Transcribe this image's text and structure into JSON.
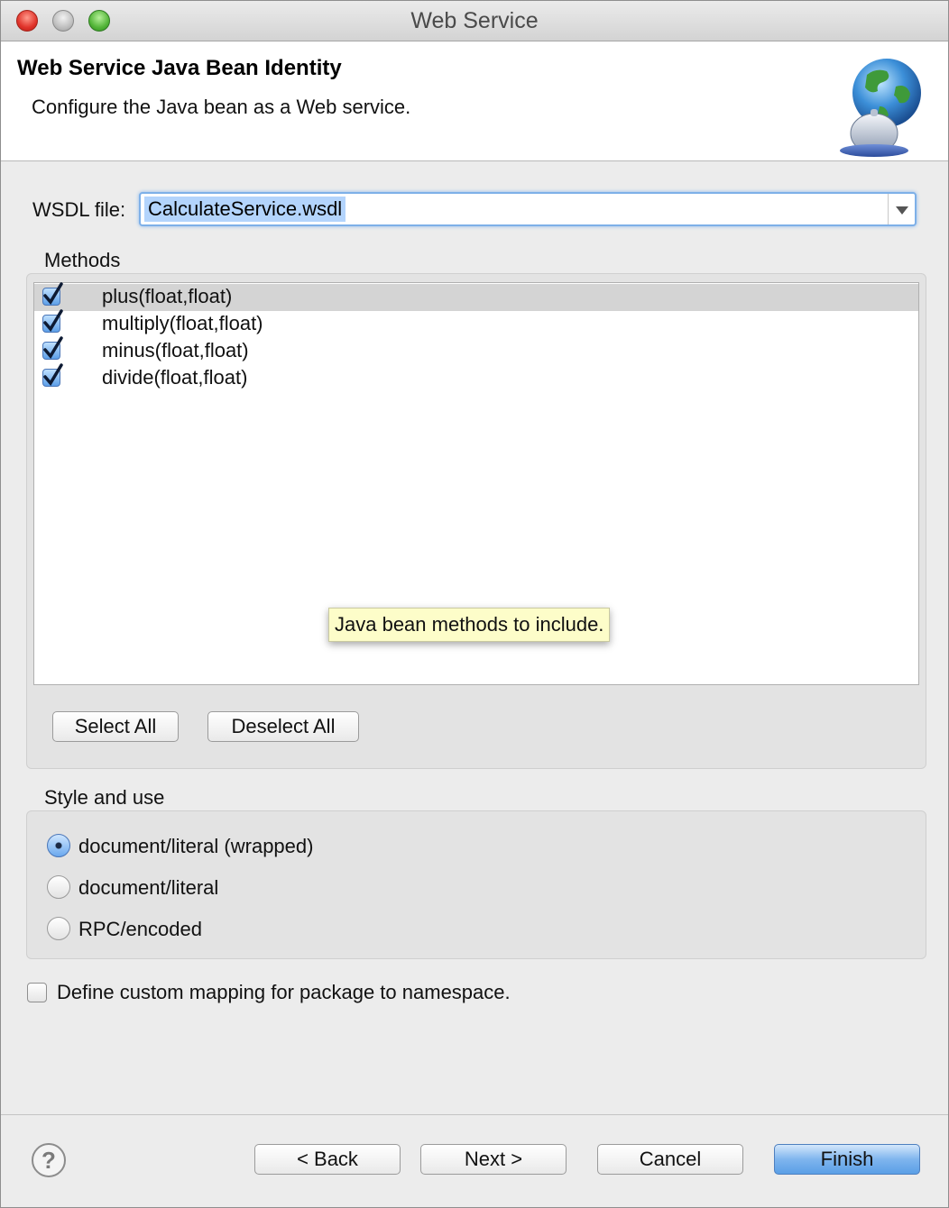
{
  "window": {
    "title": "Web Service"
  },
  "banner": {
    "title": "Web Service Java Bean Identity",
    "description": "Configure the Java bean as a Web service.",
    "icon": "globe-service-bell-icon"
  },
  "wsdl": {
    "label": "WSDL file:",
    "value": "CalculateService.wsdl"
  },
  "methods": {
    "label": "Methods",
    "items": [
      {
        "label": "plus(float,float)",
        "checked": true
      },
      {
        "label": "multiply(float,float)",
        "checked": true
      },
      {
        "label": "minus(float,float)",
        "checked": true
      },
      {
        "label": "divide(float,float)",
        "checked": true
      }
    ],
    "tooltip": "Java bean methods to include.",
    "select_all": "Select All",
    "deselect_all": "Deselect All"
  },
  "style": {
    "label": "Style and use",
    "options": [
      {
        "label": "document/literal (wrapped)",
        "selected": true
      },
      {
        "label": "document/literal",
        "selected": false
      },
      {
        "label": "RPC/encoded",
        "selected": false
      }
    ]
  },
  "custom_mapping": {
    "label": "Define custom mapping for package to namespace.",
    "checked": false
  },
  "footer": {
    "back": "< Back",
    "next": "Next >",
    "cancel": "Cancel",
    "finish": "Finish",
    "help_icon": "help-icon"
  }
}
